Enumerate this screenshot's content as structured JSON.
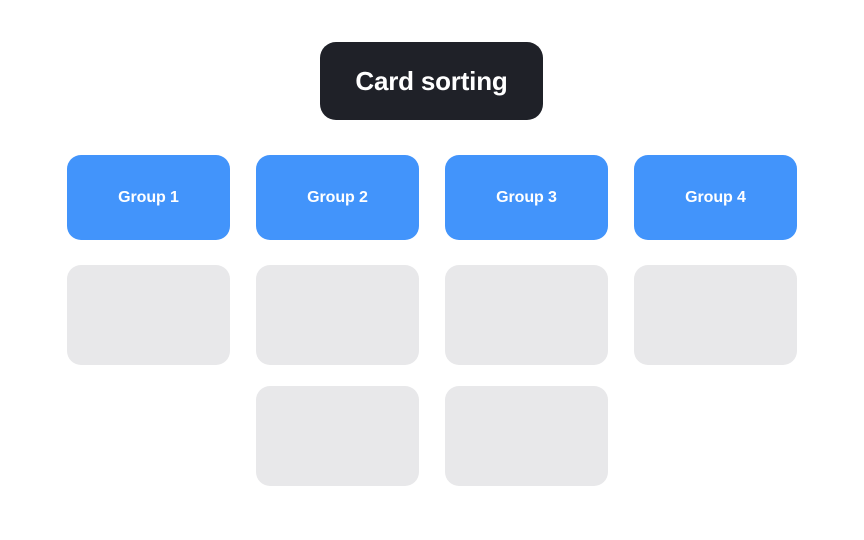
{
  "board": {
    "title": "Card sorting",
    "background_color": "#ffffff",
    "title_pill_color": "#1f2128",
    "title_text_color": "#ffffff",
    "group_color": "#4294fb",
    "group_text_color": "#ffffff",
    "card_color": "#e8e8ea",
    "columns": [
      {
        "label": "Group 1",
        "cards": [
          {
            "label": ""
          }
        ]
      },
      {
        "label": "Group 2",
        "cards": [
          {
            "label": ""
          },
          {
            "label": ""
          }
        ]
      },
      {
        "label": "Group 3",
        "cards": [
          {
            "label": ""
          },
          {
            "label": ""
          }
        ]
      },
      {
        "label": "Group 4",
        "cards": [
          {
            "label": ""
          }
        ]
      }
    ]
  }
}
